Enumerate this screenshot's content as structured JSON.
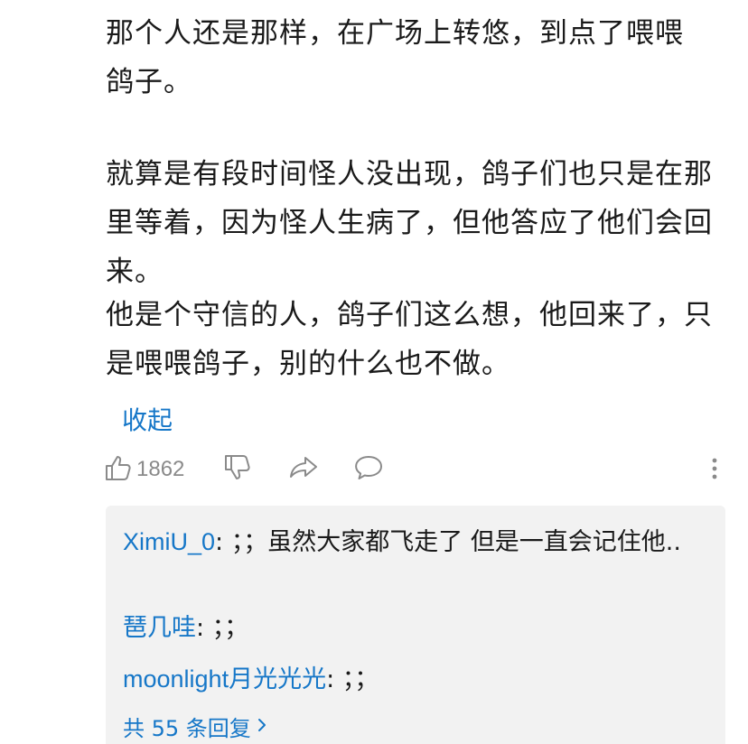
{
  "post": {
    "paragraphs": [
      "那个人还是那样，在广场上转悠，到点了喂喂鸽子。",
      "就算是有段时间怪人没出现，鸽子们也只是在那里等着，因为怪人生病了，但他答应了他们会回来。",
      "他是个守信的人，鸽子们这么想，他回来了，只是喂喂鸽子，别的什么也不做。"
    ],
    "collapse_label": "收起"
  },
  "actions": {
    "like_count": "1862",
    "icons": [
      "thumbs-up-icon",
      "thumbs-down-icon",
      "share-icon",
      "comment-icon",
      "more-vertical-icon"
    ]
  },
  "replies": {
    "items": [
      {
        "user": "XimiU_0",
        "text": ": ；；虽然大家都飞走了 但是一直会记住他.."
      },
      {
        "user": "琶几哇",
        "text": ": ；；"
      },
      {
        "user": "moonlight月光光光",
        "text": ": ；；"
      }
    ],
    "total_label": "共 55 条回复"
  },
  "colors": {
    "link": "#1677c8",
    "text": "#1a1a1a",
    "muted": "#8a8a8a",
    "reply_bg": "#f2f2f2"
  }
}
